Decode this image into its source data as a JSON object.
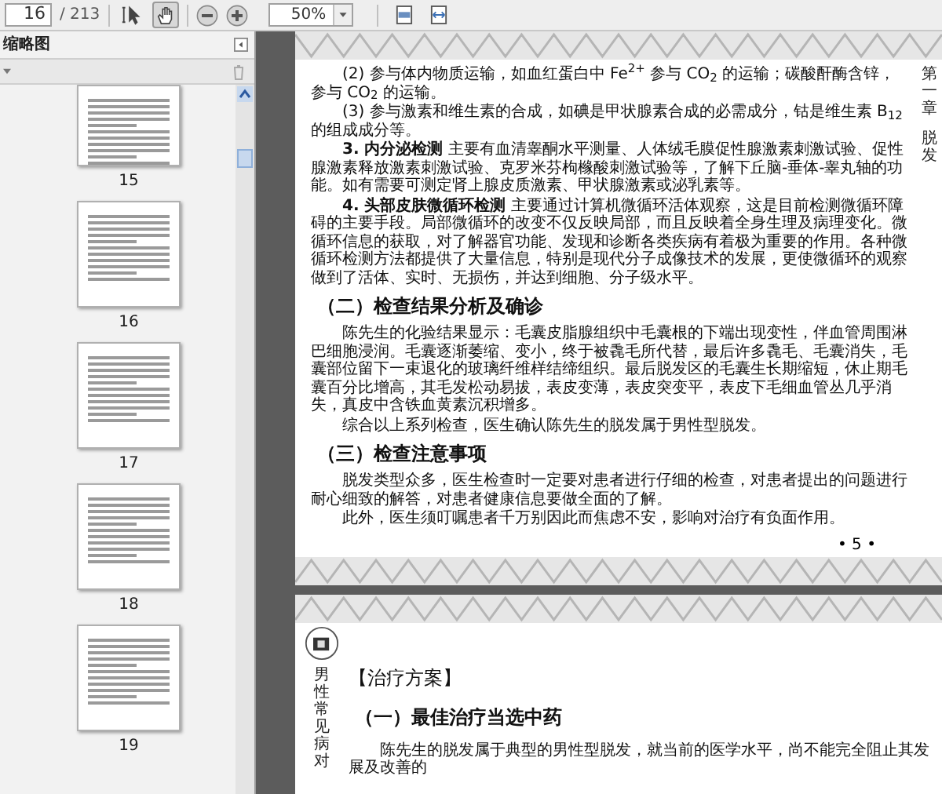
{
  "toolbar": {
    "page_input": "16",
    "page_count": "/ 213",
    "tools": [
      {
        "kind": "select",
        "selected": false
      },
      {
        "kind": "hand",
        "selected": true
      }
    ],
    "zoom": "50%"
  },
  "sidebar": {
    "title": "缩略图",
    "thumbnails": [
      {
        "label": "15"
      },
      {
        "label": "16"
      },
      {
        "label": "17"
      },
      {
        "label": "18"
      },
      {
        "label": "19"
      }
    ]
  },
  "pages": [
    {
      "side_tab": [
        "第一章",
        "脱发"
      ],
      "blocks": [
        {
          "kind": "para",
          "text": "(2) 参与体内物质运输，如血红蛋白中 Fe$^{2+}$ 参与 CO$_{2}$ 的运输；碳酸酐酶含锌，参与 CO$_{2}$ 的运输。"
        },
        {
          "kind": "para",
          "text": "(3) 参与激素和维生素的合成，如碘是甲状腺素合成的必需成分，钴是维生素 B$_{12}$ 的组成成分等。"
        },
        {
          "kind": "para",
          "text": "**3. 内分泌检测** 主要有血清睾酮水平测量、人体绒毛膜促性腺激素刺激试验、促性腺激素释放激素刺激试验、克罗米芬枸橼酸刺激试验等，了解下丘脑-垂体-睾丸轴的功能。如有需要可测定肾上腺皮质激素、甲状腺激素或泌乳素等。"
        },
        {
          "kind": "para",
          "text": "**4. 头部皮肤微循环检测** 主要通过计算机微循环活体观察，这是目前检测微循环障碍的主要手段。局部微循环的改变不仅反映局部，而且反映着全身生理及病理变化。微循环信息的获取，对了解器官功能、发现和诊断各类疾病有着极为重要的作用。各种微循环检测方法都提供了大量信息，特别是现代分子成像技术的发展，更使微循环的观察做到了活体、实时、无损伤，并达到细胞、分子级水平。"
        },
        {
          "kind": "heading",
          "text": "（二）检查结果分析及确诊"
        },
        {
          "kind": "para",
          "text": "陈先生的化验结果显示：毛囊皮脂腺组织中毛囊根的下端出现变性，伴血管周围淋巴细胞浸润。毛囊逐渐萎缩、变小，终于被毳毛所代替，最后许多毳毛、毛囊消失，毛囊部位留下一束退化的玻璃纤维样结缔组织。最后脱发区的毛囊生长期缩短，休止期毛囊百分比增高，其毛发松动易拔，表皮变薄，表皮突变平，表皮下毛细血管丛几乎消失，真皮中含铁血黄素沉积增多。"
        },
        {
          "kind": "para",
          "text": "综合以上系列检查，医生确认陈先生的脱发属于男性型脱发。"
        },
        {
          "kind": "heading",
          "text": "（三）检查注意事项"
        },
        {
          "kind": "para",
          "text": "脱发类型众多，医生检查时一定要对患者进行仔细的检查，对患者提出的问题进行耐心细致的解答，对患者健康信息要做全面的了解。"
        },
        {
          "kind": "para",
          "text": "此外，医生须叮嘱患者千万别因此而焦虑不安，影响对治疗有负面作用。"
        }
      ],
      "page_number": "• 5 •"
    },
    {
      "side_tab": [
        "男性常见病对"
      ],
      "blocks": [
        {
          "kind": "title",
          "text": "【治疗方案】"
        },
        {
          "kind": "heading",
          "text": "（一）最佳治疗当选中药"
        },
        {
          "kind": "para",
          "text": "陈先生的脱发属于典型的男性型脱发，就当前的医学水平，尚不能完全阻止其发展及改善的"
        }
      ]
    }
  ]
}
